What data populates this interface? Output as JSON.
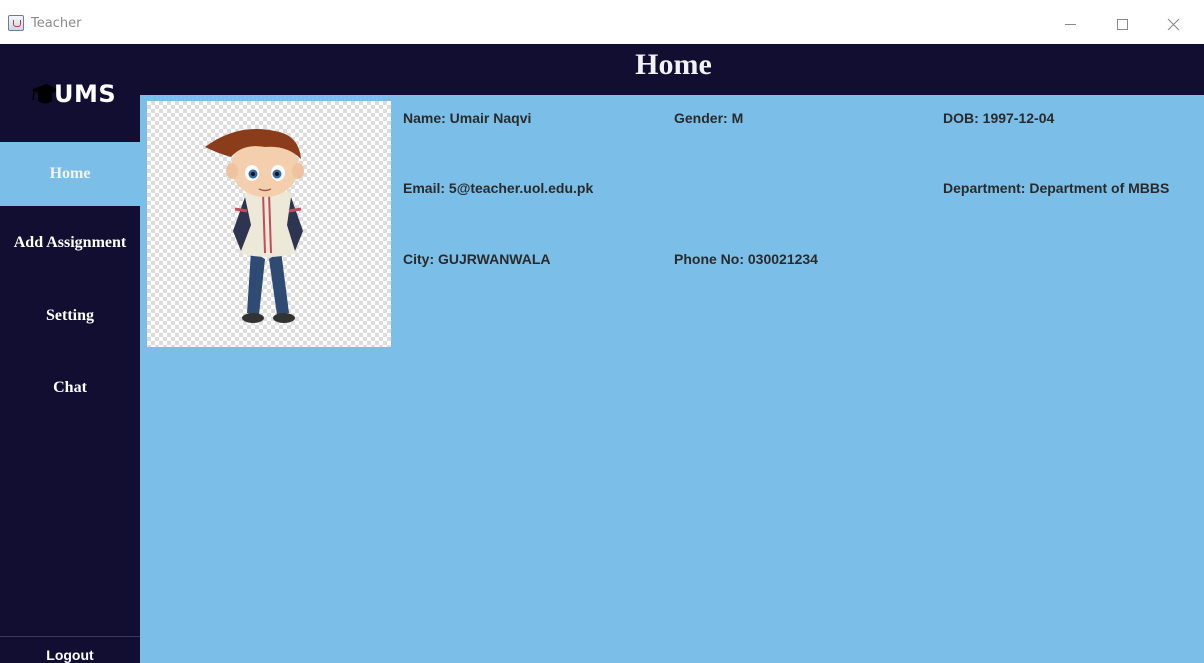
{
  "window": {
    "title": "Teacher",
    "icon": "java-cup-icon"
  },
  "header": {
    "title": "Home"
  },
  "sidebar": {
    "logo_text": "UMS",
    "items": [
      {
        "label": "Home",
        "active": true
      },
      {
        "label": "Add Assignment",
        "active": false
      },
      {
        "label": "Setting",
        "active": false
      },
      {
        "label": "Chat",
        "active": false
      }
    ],
    "logout_label": "Logout"
  },
  "profile": {
    "name": "Name: Umair Naqvi",
    "gender": "Gender: M",
    "dob": "DOB: 1997-12-04",
    "email": "Email: 5@teacher.uol.edu.pk",
    "department": "Department: Department of MBBS",
    "city": "City: GUJRWANWALA",
    "phone": "Phone No: 030021234"
  },
  "colors": {
    "sidebar_bg": "#110e31",
    "content_bg": "#7bbfe9",
    "active_nav": "#7bbfe9"
  }
}
